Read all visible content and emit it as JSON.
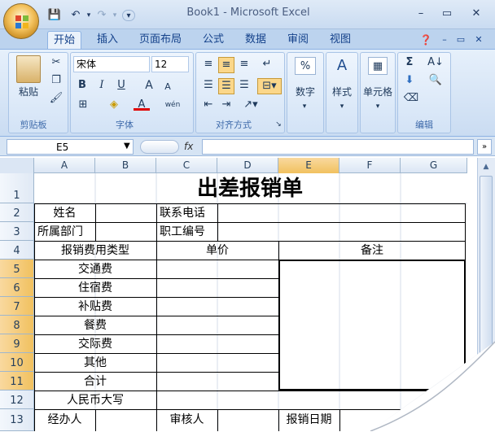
{
  "window": {
    "title": "Book1 - Microsoft Excel"
  },
  "qat": {
    "save": "💾",
    "undo": "↶",
    "redo": "↷"
  },
  "tabs": [
    "开始",
    "插入",
    "页面布局",
    "公式",
    "数据",
    "审阅",
    "视图"
  ],
  "ribbon": {
    "clipboard": {
      "paste": "粘贴",
      "label": "剪贴板"
    },
    "font": {
      "name": "宋体",
      "size": "12",
      "bold": "B",
      "italic": "I",
      "underline": "U",
      "grow": "A",
      "shrink": "A",
      "fontcolor": "A",
      "phonetic": "wén",
      "label": "字体"
    },
    "alignment": {
      "label": "对齐方式"
    },
    "number": {
      "label": "数字"
    },
    "styles": {
      "label": "样式"
    },
    "cells": {
      "label": "单元格"
    },
    "editing": {
      "sum": "Σ",
      "label": "编辑"
    }
  },
  "formula_bar": {
    "name_box": "E5",
    "fx": "fx",
    "value": ""
  },
  "columns": [
    "A",
    "B",
    "C",
    "D",
    "E",
    "F",
    "G"
  ],
  "rows": [
    "1",
    "2",
    "3",
    "4",
    "5",
    "6",
    "7",
    "8",
    "9",
    "10",
    "11",
    "12",
    "13"
  ],
  "sheet": {
    "title": "出差报销单",
    "name_label": "姓名",
    "phone_label": "联系电话",
    "dept_label": "所属部门",
    "staff_id_label": "职工编号",
    "expense_type_header": "报销费用类型",
    "unit_price_header": "单价",
    "note_header": "备注",
    "items": [
      "交通费",
      "住宿费",
      "补贴费",
      "餐费",
      "交际费",
      "其他",
      "合计"
    ],
    "rmb_label": "人民币大写",
    "handler_label": "经办人",
    "reviewer_label": "审核人",
    "date_label": "报销日期"
  },
  "colors": {
    "selected_header": "#f1c15f",
    "ribbon_text": "#15428b"
  }
}
